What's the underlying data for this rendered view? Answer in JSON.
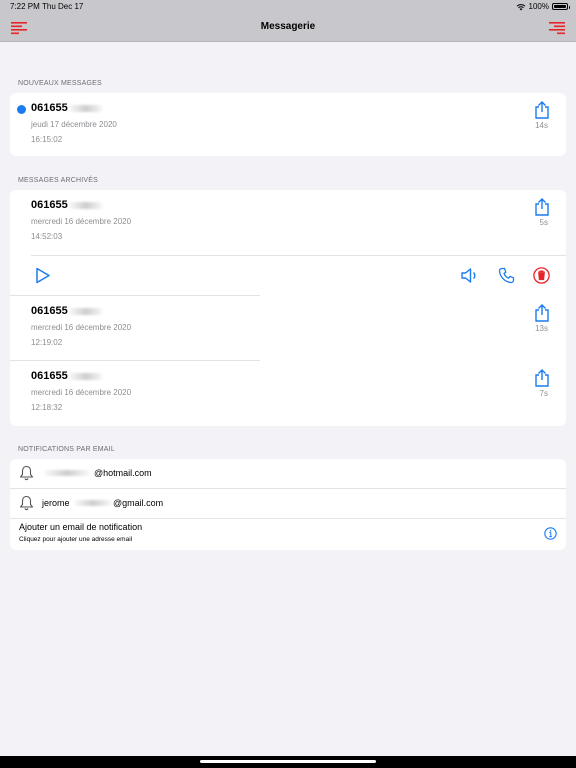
{
  "status_bar": {
    "time": "7:22 PM",
    "date": "Thu Dec 17",
    "battery": "100%"
  },
  "nav": {
    "title": "Messagerie"
  },
  "sections": {
    "new": "NOUVEAUX MESSAGES",
    "archived": "MESSAGES ARCHIVÉS",
    "email": "NOTIFICATIONS PAR EMAIL"
  },
  "new_messages": [
    {
      "number": "061655",
      "date": "jeudi 17 décembre 2020",
      "time": "16:15:02",
      "duration": "14s"
    }
  ],
  "archived_messages": [
    {
      "number": "061655",
      "date": "mercredi 16 décembre 2020",
      "time": "14:52:03",
      "duration": "5s"
    },
    {
      "number": "061655",
      "date": "mercredi 16 décembre 2020",
      "time": "12:19:02",
      "duration": "13s"
    },
    {
      "number": "061655",
      "date": "mercredi 16 décembre 2020",
      "time": "12:18:32",
      "duration": "7s"
    }
  ],
  "emails": [
    {
      "prefix": "",
      "domain": "@hotmail.com"
    },
    {
      "prefix": "jerome",
      "domain": "@gmail.com"
    }
  ],
  "add_email": {
    "title": "Ajouter un email de notification",
    "subtitle": "Cliquez pour ajouter une adresse email"
  },
  "colors": {
    "accent": "#1a7cf2",
    "menu": "#e8232a",
    "delete": "#e8232a"
  }
}
